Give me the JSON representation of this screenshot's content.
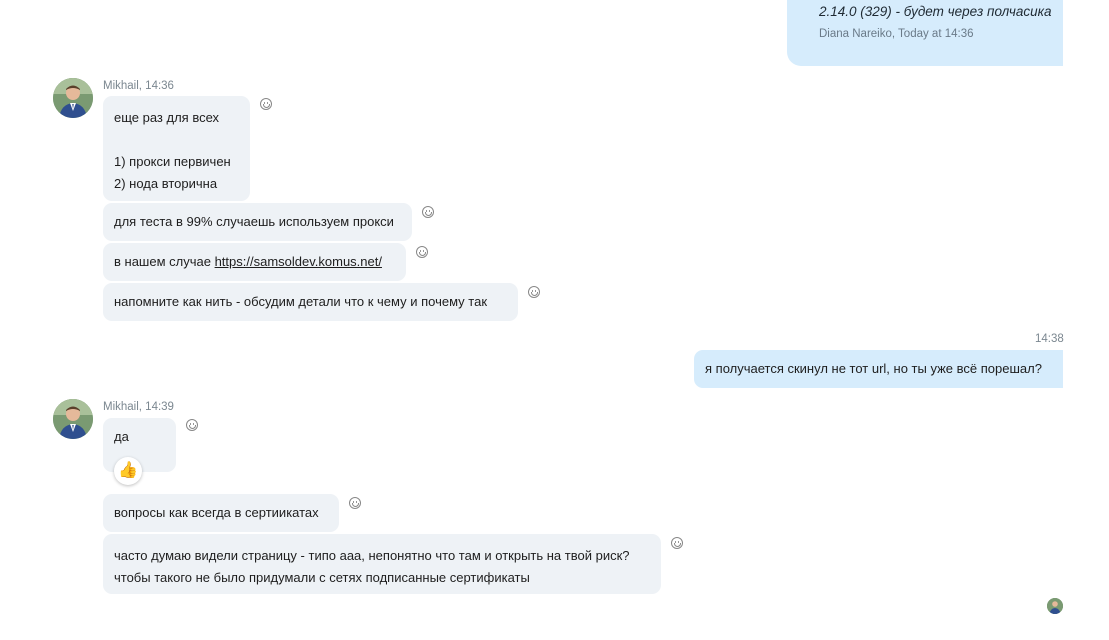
{
  "quoted": {
    "text": "2.14.0 (329) - будет через полчасика",
    "author_line": "Diana Nareiko, Today at 14:36"
  },
  "group1": {
    "sender_time": "Mikhail, 14:36",
    "messages": [
      {
        "lines": [
          "еще раз для всех",
          "",
          "1) прокси первичен",
          "2) нода вторична"
        ]
      },
      {
        "text": "для теста в 99% случаешь используем прокси"
      },
      {
        "prefix": "в нашем случае ",
        "link": "https://samsoldev.komus.net/"
      },
      {
        "text": "напомните как нить - обсудим детали что к чему и почему так"
      }
    ]
  },
  "outgoing": {
    "time": "14:38",
    "text": "я получается скинул не тот url, но ты уже всё порешал?"
  },
  "group2": {
    "sender_time": "Mikhail, 14:39",
    "messages": [
      {
        "text": "да",
        "reaction": "👍"
      },
      {
        "text": "вопросы как всегда в сертиикатах"
      },
      {
        "lines": [
          "часто думаю видели страницу - типо ааа, непонятно что там и открыть на твой риск?",
          "чтобы такого не было придумали с сетях подписанные сертификаты"
        ]
      }
    ]
  }
}
